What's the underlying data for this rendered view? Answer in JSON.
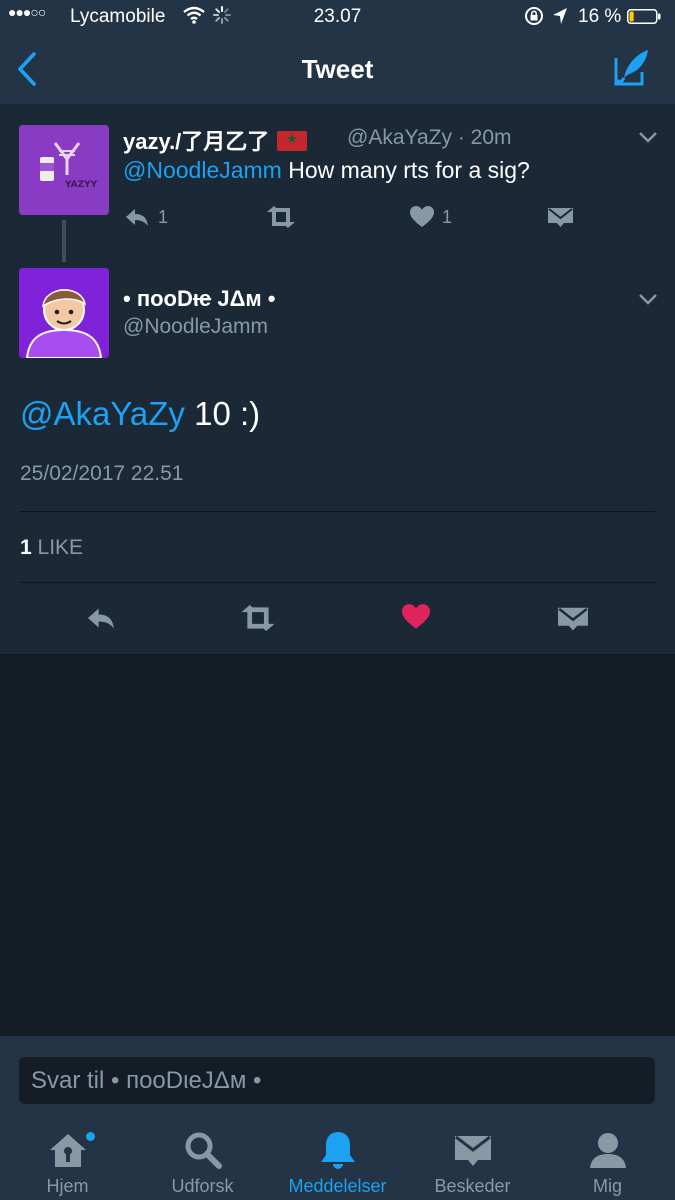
{
  "status_bar": {
    "signal": "●●●○○",
    "carrier": "Lycamobile",
    "time": "23.07",
    "battery_percent": "16 %",
    "battery_level": 0.16
  },
  "nav": {
    "title": "Tweet",
    "back_icon": "back-chevron-icon",
    "compose_icon": "compose-tweet-icon"
  },
  "parent_tweet": {
    "name": "yazy./了月乙了",
    "flag": "morocco-flag",
    "handle": "@AkaYaZy",
    "time": "· 20m",
    "mention": "@NoodleJamm",
    "text": " How many rts for a sig?",
    "reply_count": "1",
    "like_count": "1",
    "avatar_text": "YAZYY"
  },
  "main_tweet": {
    "name_prefix": "• пooD",
    "name_strike": "ι",
    "name_strike2": "e",
    "name_suffix": " JΔм •",
    "handle": "@NoodleJamm",
    "mention": "@AkaYaZy",
    "text": " 10 :)",
    "timestamp": "25/02/2017 22.51",
    "like_count": "1",
    "like_label": " LIKE",
    "liked": true
  },
  "reply": {
    "placeholder": "Svar til • пooDιeJΔм •"
  },
  "tabs": [
    {
      "label": "Hjem",
      "icon": "home-icon"
    },
    {
      "label": "Udforsk",
      "icon": "search-icon"
    },
    {
      "label": "Meddelelser",
      "icon": "bell-icon",
      "active": true
    },
    {
      "label": "Beskeder",
      "icon": "envelope-icon"
    },
    {
      "label": "Mig",
      "icon": "person-icon"
    }
  ],
  "colors": {
    "accent": "#1da1f2",
    "like": "#e0245e",
    "muted": "#8899a6",
    "background": "#141d26",
    "panel": "#1b2836",
    "bar": "#243447",
    "battery": "#ffcc00"
  }
}
